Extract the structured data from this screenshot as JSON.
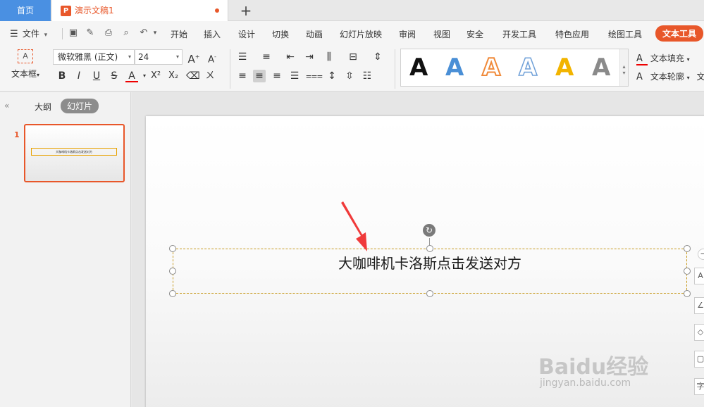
{
  "tabs": {
    "home": "首页",
    "doc_icon": "P",
    "doc_name": "演示文稿1",
    "add": "+"
  },
  "menu": {
    "file": "文件",
    "items": [
      "开始",
      "插入",
      "设计",
      "切换",
      "动画",
      "幻灯片放映",
      "审阅",
      "视图",
      "安全",
      "开发工具",
      "特色应用",
      "绘图工具"
    ],
    "active": "文本工具"
  },
  "ribbon": {
    "textbox_label": "文本框",
    "font_name": "微软雅黑 (正文)",
    "font_size": "24",
    "style_letter": "A",
    "style_colors": [
      "#111111",
      "#4a8fd6",
      "#f08a3a",
      "#6fa0d8",
      "#f2b400",
      "#8a8a8a"
    ],
    "text_fill": "文本填充",
    "text_outline": "文本轮廓",
    "text_more": "文"
  },
  "leftpane": {
    "outline_tab": "大纲",
    "slides_tab": "幻灯片",
    "slide_number": "1"
  },
  "slide": {
    "text": "大咖啡机卡洛斯点击发送对方"
  },
  "watermark": {
    "main": "Baidu经验",
    "sub": "jingyan.baidu.com"
  },
  "colors": {
    "accent": "#e8572a",
    "home_tab": "#4a90e2"
  }
}
